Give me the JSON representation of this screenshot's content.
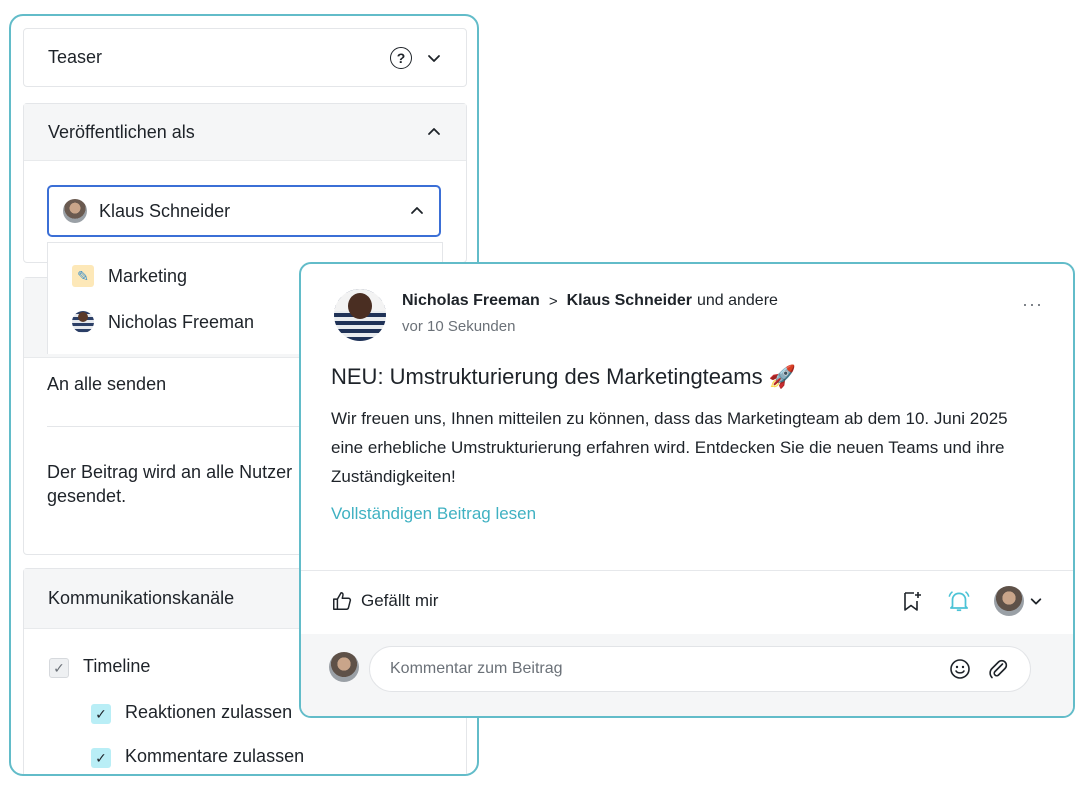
{
  "settings": {
    "teaser": {
      "label": "Teaser"
    },
    "publish_as": {
      "label": "Veröffentlichen als",
      "selected": "Klaus Schneider",
      "options": [
        {
          "label": "Marketing"
        },
        {
          "label": "Nicholas Freeman"
        }
      ]
    },
    "send_all": {
      "label": "An alle senden",
      "description_line1": "Der Beitrag wird an alle Nutzer",
      "description_line2": "gesendet."
    },
    "channels": {
      "label": "Kommunikationskanäle",
      "timeline": "Timeline",
      "reactions": "Reaktionen zulassen",
      "comments": "Kommentare zulassen"
    }
  },
  "post": {
    "author": "Nicholas Freeman",
    "target": "Klaus Schneider",
    "and_others": "und andere",
    "timestamp": "vor 10 Sekunden",
    "title": "NEU: Umstrukturierung des Marketingteams 🚀",
    "body": "Wir freuen uns, Ihnen mitteilen zu können, dass das Marketingteam ab dem 10. Juni 2025 eine erhebliche Umstrukturierung erfahren wird. Entdecken Sie die neuen Teams und ihre Zuständigkeiten!",
    "read_more": "Vollständigen Beitrag lesen",
    "like_label": "Gefällt mir",
    "more_label": "···",
    "comment_placeholder": "Kommentar zum Beitrag"
  },
  "colors": {
    "frame": "#62bcc9",
    "focus": "#3b6fd6",
    "link": "#3fb1c2",
    "bell": "#4cc3d6"
  },
  "icons": [
    "help-icon",
    "chevron-down-icon",
    "chevron-up-icon",
    "thumbs-up-icon",
    "bookmark-add-icon",
    "bell-icon",
    "emoji-icon",
    "paperclip-icon",
    "more-icon",
    "checkmark-icon"
  ]
}
